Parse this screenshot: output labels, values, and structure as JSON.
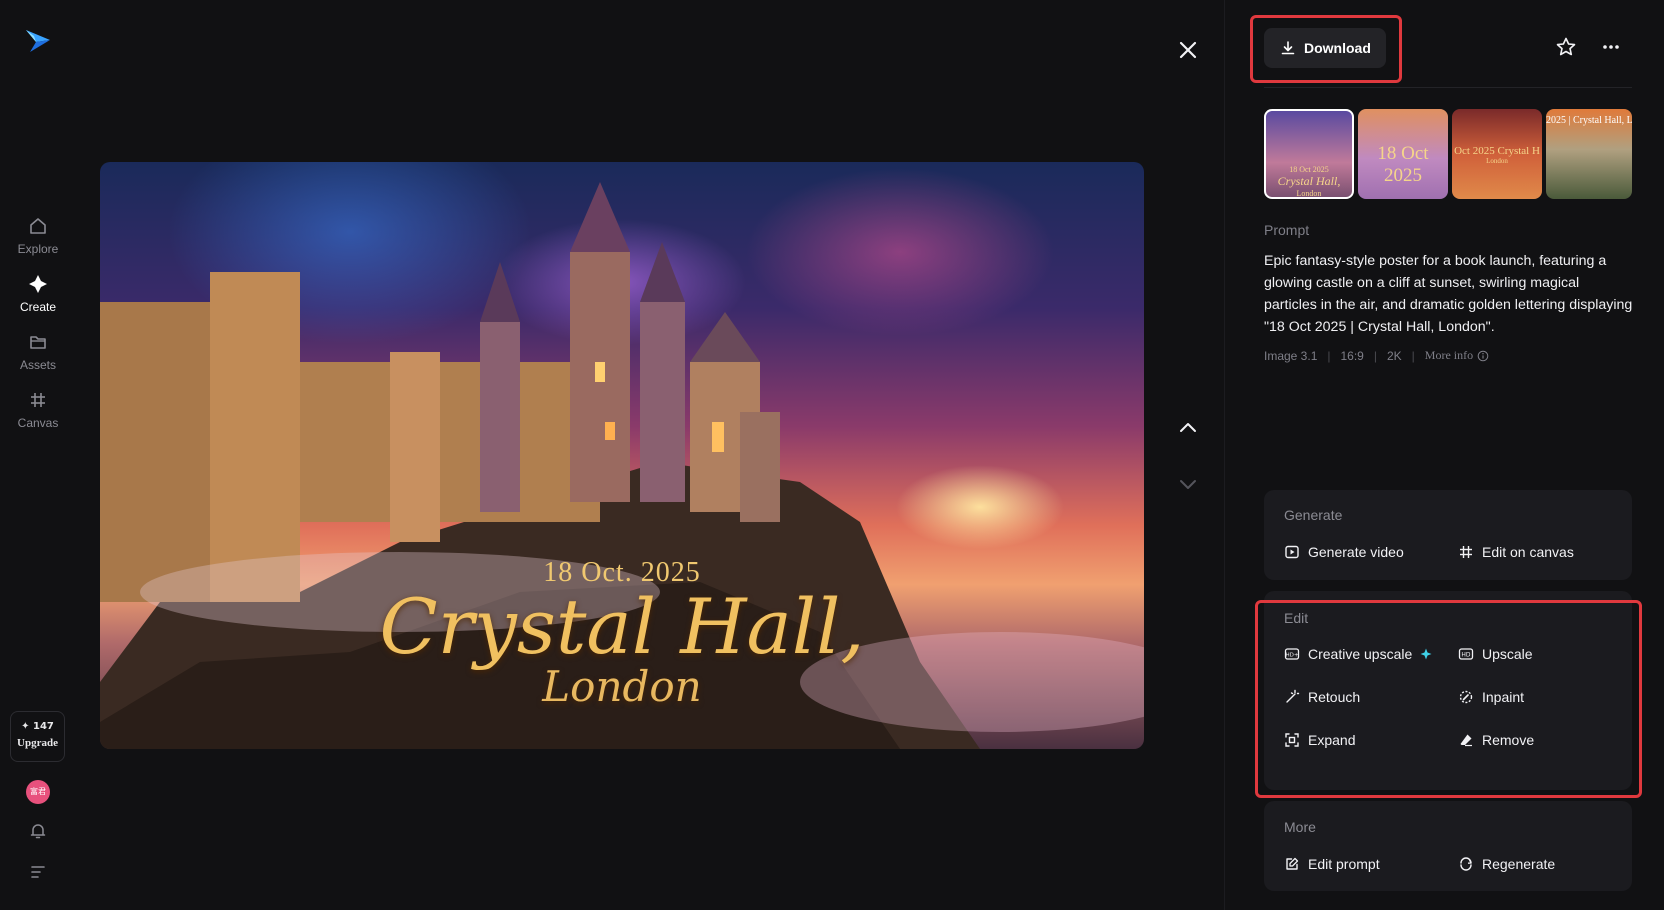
{
  "nav": {
    "items": [
      {
        "label": "Explore",
        "icon": "home-icon",
        "active": false
      },
      {
        "label": "Create",
        "icon": "sparkle-icon",
        "active": true
      },
      {
        "label": "Assets",
        "icon": "folder-icon",
        "active": false
      },
      {
        "label": "Canvas",
        "icon": "canvas-icon",
        "active": false
      }
    ],
    "credits": "✦ 147",
    "upgrade_label": "Upgrade",
    "avatar_text": "富君"
  },
  "hero": {
    "date": "18 Oct. 2025",
    "title": "Crystal Hall,",
    "subtitle": "London"
  },
  "panel": {
    "download_label": "Download",
    "thumbnails": [
      {
        "line1": "18 Oct 2025",
        "line2": "Crystal Hall,",
        "line3": "London",
        "selected": true
      },
      {
        "line1": "18 Oct 2025",
        "line2": "",
        "line3": "",
        "selected": false
      },
      {
        "line1": "Oct 2025 Crystal H",
        "line2": "London",
        "line3": "",
        "selected": false
      },
      {
        "line1": "2025 | Crystal Hall, L",
        "line2": "",
        "line3": "",
        "selected": false
      }
    ],
    "prompt_label": "Prompt",
    "prompt_text": "Epic fantasy-style poster for a book launch, featuring a glowing castle on a cliff at sunset, swirling magical particles in the air, and dramatic golden lettering displaying \"18 Oct 2025 | Crystal Hall, London\".",
    "meta": {
      "model": "Image 3.1",
      "ratio": "16:9",
      "resolution": "2K",
      "more_info": "More info"
    },
    "generate": {
      "title": "Generate",
      "generate_video": "Generate video",
      "edit_on_canvas": "Edit on canvas"
    },
    "edit": {
      "title": "Edit",
      "creative_upscale": "Creative upscale",
      "upscale": "Upscale",
      "retouch": "Retouch",
      "inpaint": "Inpaint",
      "expand": "Expand",
      "remove": "Remove"
    },
    "more": {
      "title": "More",
      "edit_prompt": "Edit prompt",
      "regenerate": "Regenerate"
    }
  },
  "colors": {
    "accent_red": "#e0393e",
    "sparkle_cyan": "#3fd0e6",
    "bg": "#111113",
    "card": "#1b1b1f"
  }
}
